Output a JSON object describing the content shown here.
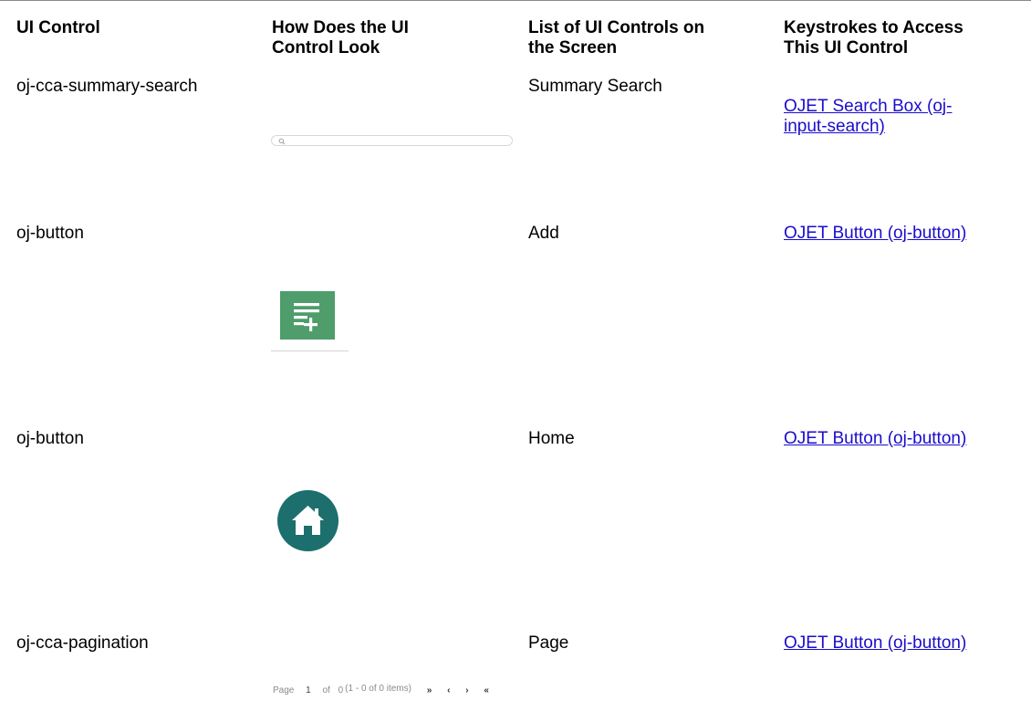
{
  "headers": [
    "UI Control",
    "How Does the UI\nControl Look",
    "List of UI Controls on\nthe Screen",
    "Keystrokes to Access\nThis UI Control"
  ],
  "rows": [
    {
      "control": "oj-cca-summary-search",
      "screen_control": "Summary Search",
      "keystroke_link": "OJET Search Box (oj-\ninput-search)",
      "look": {
        "type": "search-box",
        "icon": "search-icon"
      }
    },
    {
      "control": "oj-button",
      "screen_control": "Add",
      "keystroke_link": "OJET Button (oj-button)",
      "look": {
        "type": "button",
        "icon": "add-list-icon",
        "color": "#4e9d6b"
      }
    },
    {
      "control": "oj-button",
      "screen_control": "Home",
      "keystroke_link": "OJET Button (oj-button)",
      "look": {
        "type": "button",
        "icon": "home-icon",
        "color": "#1c6f6c"
      }
    },
    {
      "control": "oj-cca-pagination",
      "screen_control": "Page",
      "keystroke_link": "OJET Button (oj-button)",
      "look": {
        "type": "pagination",
        "page_label": "Page",
        "page_number": "1",
        "of_label": "of",
        "total_pages": "0",
        "range_text": "(1 - 0 of 0 items)",
        "last_glyph": "»",
        "prev_glyph": "‹",
        "next_glyph": "›",
        "first_glyph": "«"
      }
    }
  ],
  "colors": {
    "link": "#1a0dcc",
    "add_button": "#4e9d6b",
    "home_button": "#1c6f6c"
  }
}
